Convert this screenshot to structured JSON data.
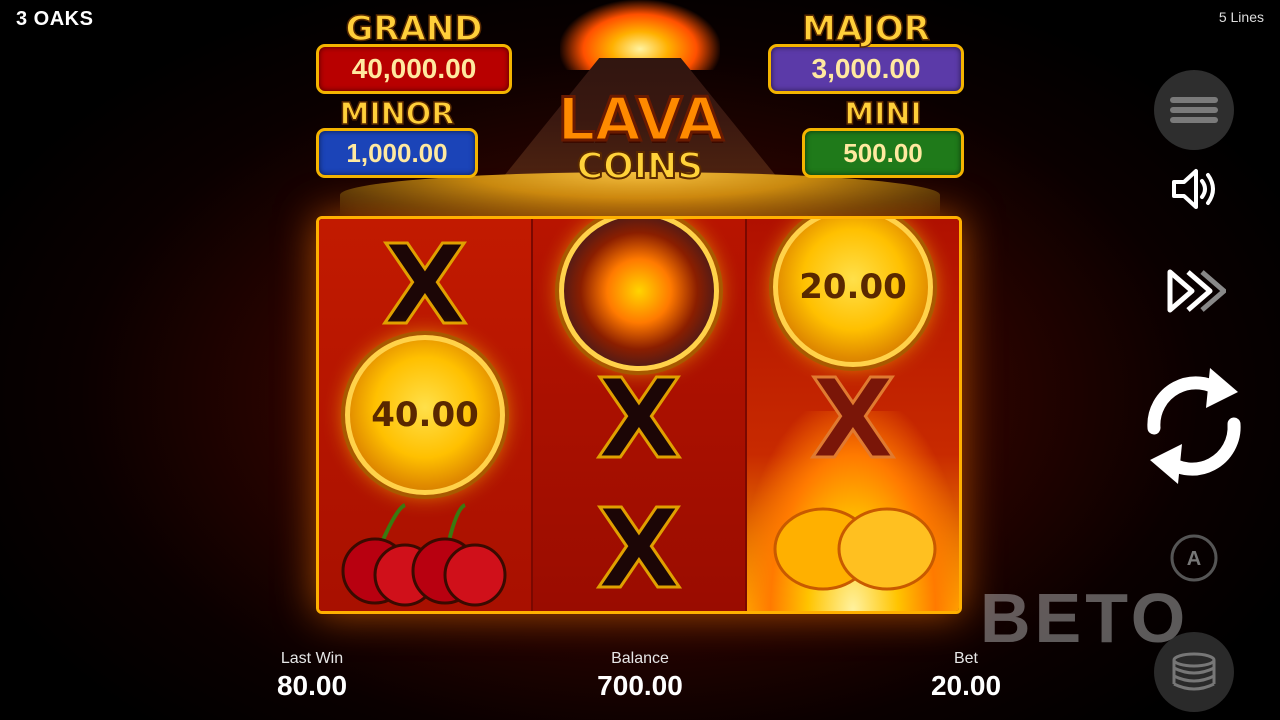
{
  "header": {
    "brand": "3 OAKS",
    "lines": "5 Lines"
  },
  "logo": {
    "line1": "LAVA",
    "line2": "COINS"
  },
  "jackpots": {
    "grand": {
      "title": "GRAND",
      "value": "40,000.00"
    },
    "major": {
      "title": "MAJOR",
      "value": "3,000.00"
    },
    "minor": {
      "title": "MINOR",
      "value": "1,000.00"
    },
    "mini": {
      "title": "MINI",
      "value": "500.00"
    }
  },
  "reels": {
    "r1": {
      "top": "X",
      "coin": "40.00"
    },
    "r2": {
      "mid": "X",
      "bottom": "X"
    },
    "r3": {
      "coin": "20.00",
      "mid": "X"
    }
  },
  "stats": {
    "last_win_label": "Last Win",
    "last_win": "80.00",
    "balance_label": "Balance",
    "balance": "700.00",
    "bet_label": "Bet",
    "bet": "20.00"
  },
  "controls": {
    "auto_letter": "A",
    "icons": [
      "menu-icon",
      "sound-icon",
      "turbo-icon",
      "spin-icon",
      "autoplay-icon",
      "chips-icon"
    ]
  },
  "watermark": "BETO"
}
